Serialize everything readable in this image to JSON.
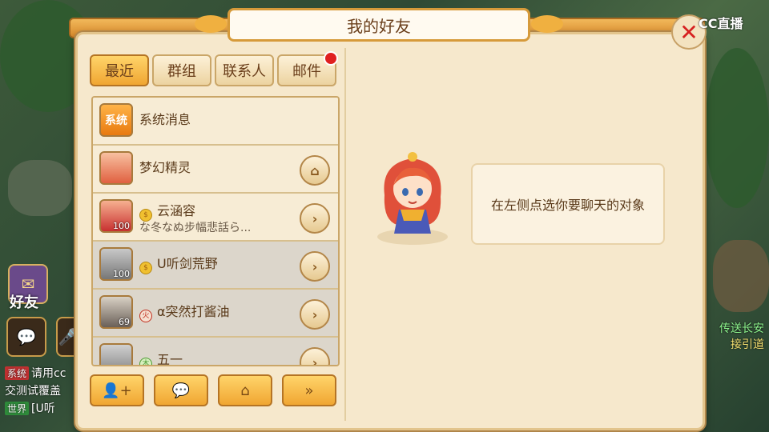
{
  "window": {
    "title": "我的好友"
  },
  "watermark": "CC直播",
  "tabs": [
    {
      "label": "最近",
      "active": true
    },
    {
      "label": "群组",
      "active": false
    },
    {
      "label": "联系人",
      "active": false
    },
    {
      "label": "邮件",
      "active": false,
      "badge": true
    }
  ],
  "list": [
    {
      "name": "系统消息",
      "message": "",
      "avatar": "系统",
      "level": "",
      "action": ""
    },
    {
      "name": "梦幻精灵",
      "message": "",
      "avatar": "",
      "level": "",
      "action": "home"
    },
    {
      "name": "云涵容",
      "message": "な冬なぬ步幅悲話ら...",
      "avatar": "",
      "level": "100",
      "action": "arrow"
    },
    {
      "name": "U听剑荒野",
      "message": "",
      "avatar": "",
      "level": "100",
      "action": "arrow"
    },
    {
      "name": "α突然打酱油",
      "message": "",
      "avatar": "",
      "level": "69",
      "action": "arrow"
    },
    {
      "name": "五一",
      "message": "",
      "avatar": "",
      "level": "",
      "action": "arrow"
    }
  ],
  "bottom_buttons": [
    "add-friend",
    "chat",
    "home",
    "more"
  ],
  "hint": "在左侧点选你要聊天的对象",
  "hud": {
    "friends_label": "好友",
    "chat_lines": [
      {
        "tag": "系统",
        "text": "请用cc"
      },
      {
        "tag": "",
        "text": "交测试覆盖"
      },
      {
        "tag": "世界",
        "text": "[U听"
      }
    ],
    "right_lines": [
      "传送长安",
      "接引道"
    ]
  },
  "colors": {
    "accent": "#f0a632",
    "panel": "#f6e8cc",
    "badge": "#e02020"
  }
}
